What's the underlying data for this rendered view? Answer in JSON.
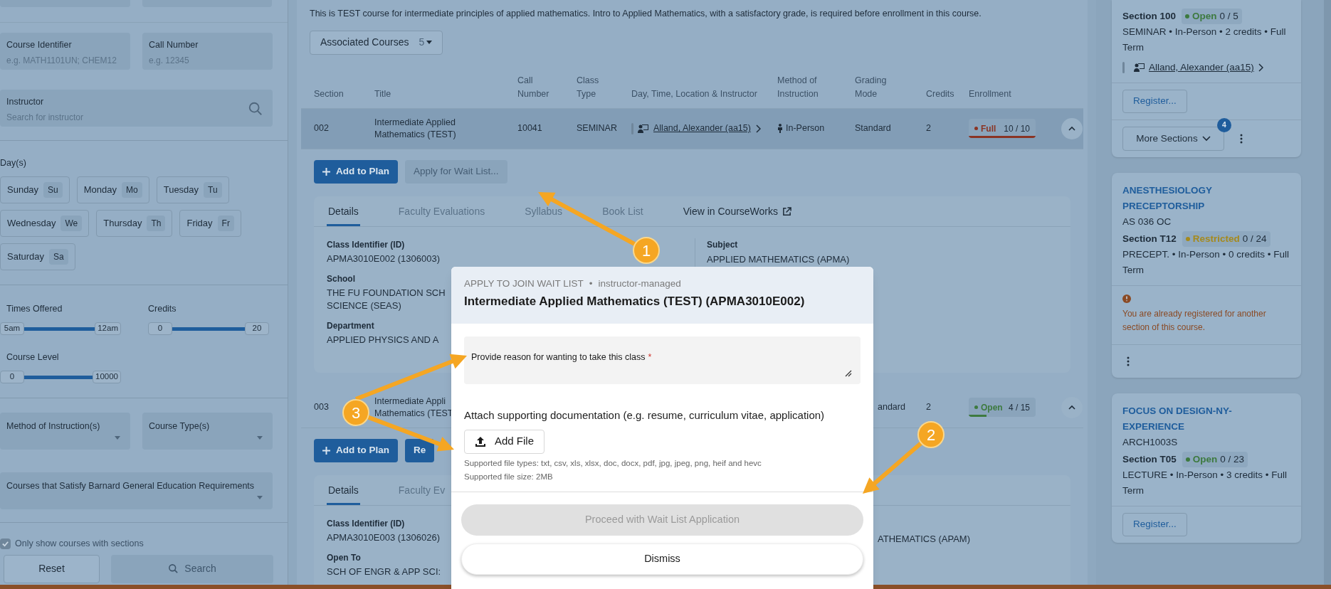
{
  "sidebar": {
    "fields": [
      {
        "label": "Course Identifier",
        "placeholder": "e.g. MATH1101UN; CHEM12"
      },
      {
        "label": "Call Number",
        "placeholder": "e.g. 12345"
      }
    ],
    "instructor": {
      "label": "Instructor",
      "placeholder": "Search for instructor"
    },
    "days_label": "Day(s)",
    "days": [
      {
        "label": "Sunday",
        "abbr": "Su"
      },
      {
        "label": "Monday",
        "abbr": "Mo"
      },
      {
        "label": "Tuesday",
        "abbr": "Tu"
      },
      {
        "label": "Wednesday",
        "abbr": "We"
      },
      {
        "label": "Thursday",
        "abbr": "Th"
      },
      {
        "label": "Friday",
        "abbr": "Fr"
      },
      {
        "label": "Saturday",
        "abbr": "Sa"
      }
    ],
    "ranges": [
      {
        "label": "Times Offered",
        "min": "5am",
        "max": "12am",
        "level": 1
      },
      {
        "label": "Credits",
        "min": "0",
        "max": "20",
        "level": 1
      },
      {
        "label": "Course Level",
        "min": "0",
        "max": "10000",
        "level": 1
      }
    ],
    "dropdowns": [
      {
        "label": "Method of Instruction(s)"
      },
      {
        "label": "Course Type(s)"
      },
      {
        "label": "Courses that Satisfy Barnard General Education Requirements"
      }
    ],
    "checkbox": {
      "label": "Only show courses with sections",
      "checked": true
    },
    "reset": "Reset",
    "search": "Search"
  },
  "main": {
    "description": "This is TEST course for intermediate principles of applied mathematics. Intro to Applied Mathematics, with a satisfactory grade, is required before enrollment in this course.",
    "associated": {
      "label": "Associated Courses",
      "count": "5"
    },
    "columns": [
      "Section",
      "Title",
      "Call Number",
      "Class Type",
      "Day, Time, Location & Instructor",
      "Method of Instruction",
      "Grading Mode",
      "Credits",
      "Enrollment"
    ],
    "sections": [
      {
        "section": "002",
        "title": [
          "Intermediate Applied",
          "Mathematics (TEST)"
        ],
        "call_number": "10041",
        "class_type": "SEMINAR",
        "instructor": "Alland, Alexander (aa15)",
        "method": "In-Person",
        "grading": "Standard",
        "credits": "2",
        "status": {
          "kind": "full",
          "label": "Full"
        },
        "enrollment": "10 / 10",
        "level": 1,
        "selected": true,
        "expanded": true,
        "buttons": [
          {
            "label": "Add to Plan",
            "kind": "primary"
          },
          {
            "label": "Apply for Wait List...",
            "kind": "disabled"
          }
        ],
        "tabs": [
          {
            "label": "Details",
            "selected": true
          },
          {
            "label": "Faculty Evaluations",
            "selected": false
          },
          {
            "label": "Syllabus",
            "selected": false
          },
          {
            "label": "Book List",
            "selected": false
          },
          {
            "label": "View in CourseWorks",
            "selected": false,
            "external": true
          }
        ],
        "left": [
          {
            "label": "Class Identifier (ID)",
            "value": [
              "APMA3010E002 (1306003)"
            ]
          },
          {
            "label": "School",
            "value": [
              "THE FU FOUNDATION SCH",
              "SCIENCE (SEAS)"
            ]
          },
          {
            "label": "Department",
            "value": [
              "APPLIED PHYSICS AND A"
            ]
          }
        ],
        "right": [
          {
            "label": "Subject",
            "value": [
              "APPLIED MATHEMATICS (APMA)"
            ]
          }
        ]
      },
      {
        "section": "003",
        "title": [
          "Intermediate Appli",
          "Mathematics (TEST"
        ],
        "grading": "andard",
        "credits": "2",
        "status": {
          "kind": "open",
          "label": "Open"
        },
        "enrollment": "4 / 15",
        "level": 0.27,
        "selected": false,
        "expanded": true,
        "buttons": [
          {
            "label": "Add to Plan",
            "kind": "primary"
          },
          {
            "label": "Re",
            "kind": "primary"
          }
        ],
        "tabs": [
          {
            "label": "Details",
            "selected": true
          },
          {
            "label": "Faculty Ev",
            "selected": false
          }
        ],
        "left": [
          {
            "label": "Class Identifier (ID)",
            "value": [
              "APMA3010E003 (1306026)"
            ]
          },
          {
            "label": "Open To",
            "value": [
              "SCH OF ENGR & APP SCI:"
            ]
          }
        ],
        "right": [
          {
            "value": [
              "ATHEMATICS (APAM)"
            ]
          }
        ]
      }
    ]
  },
  "cards": [
    {
      "section": "Section 100",
      "status": {
        "kind": "open",
        "label": "Open"
      },
      "count": "0 / 5",
      "meta": "SEMINAR • In-Person • 2 credits • Full Term",
      "instructor": "Alland, Alexander (aa15)",
      "register": "Register...",
      "more": {
        "label": "More Sections",
        "badge": "4"
      }
    },
    {
      "title": "ANESTHESIOLOGY PRECEPTORSHIP",
      "code": "AS 036 OC",
      "section": "Section T12",
      "status": {
        "kind": "restricted",
        "label": "Restricted"
      },
      "count": "0 / 24",
      "meta": "PRECEPT. • In-Person • 0 credits • Full Term",
      "warning": "You are already registered for another section of this course."
    },
    {
      "title": "FOCUS ON DESIGN-NY-EXPERIENCE",
      "code": "ARCH1003S",
      "section": "Section T05",
      "status": {
        "kind": "open",
        "label": "Open"
      },
      "count": "0 / 23",
      "meta": "LECTURE • In-Person • 3 credits • Full Term",
      "register": "Register..."
    }
  ],
  "modal": {
    "kicker": "APPLY TO JOIN WAIT LIST",
    "separator": "•",
    "mode": "instructor-managed",
    "title": "Intermediate Applied Mathematics (TEST) (APMA3010E002)",
    "reason": {
      "label": "Provide reason for wanting to take this class",
      "required_mark": "*"
    },
    "attach_label": "Attach supporting documentation (e.g. resume, curriculum vitae, application)",
    "add_file": "Add File",
    "notes": [
      "Supported file types: txt, csv, xls, xlsx, doc, docx, pdf, jpg, jpeg, png, heif and hevc",
      "Supported file size: 2MB"
    ],
    "proceed": {
      "label": "Proceed with Wait List Application",
      "disabled": true
    },
    "dismiss": "Dismiss"
  },
  "callouts": [
    {
      "number": "1"
    },
    {
      "number": "2"
    },
    {
      "number": "3"
    }
  ]
}
